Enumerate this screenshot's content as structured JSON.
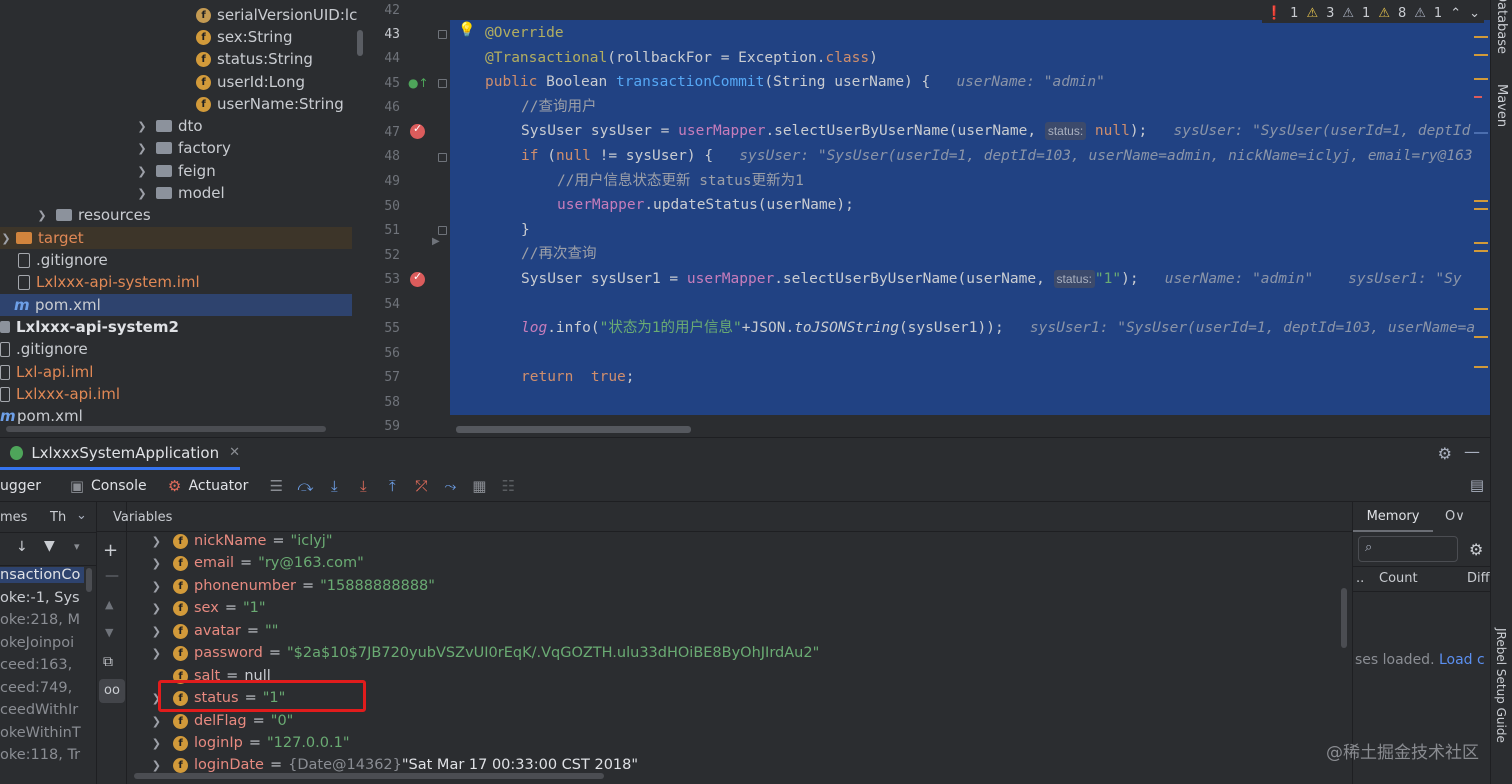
{
  "project": {
    "tree": [
      {
        "label": "serialVersionUID:lc",
        "type": "field-icon-alt",
        "style": "normal"
      },
      {
        "label": "sex:String",
        "type": "field",
        "style": "normal"
      },
      {
        "label": "status:String",
        "type": "field",
        "style": "normal"
      },
      {
        "label": "userId:Long",
        "type": "field",
        "style": "normal"
      },
      {
        "label": "userName:String",
        "type": "field",
        "style": "normal"
      },
      {
        "label": "dto",
        "type": "folder",
        "style": "normal"
      },
      {
        "label": "factory",
        "type": "folder",
        "style": "normal"
      },
      {
        "label": "feign",
        "type": "folder",
        "style": "normal"
      },
      {
        "label": "model",
        "type": "folder",
        "style": "normal"
      },
      {
        "label": "resources",
        "type": "folder",
        "style": "normal"
      },
      {
        "label": "target",
        "type": "folder-orange",
        "style": "orange"
      },
      {
        "label": ".gitignore",
        "type": "file",
        "style": "normal"
      },
      {
        "label": "Lxlxxx-api-system.iml",
        "type": "file",
        "style": "orange"
      },
      {
        "label": "pom.xml",
        "type": "maven",
        "style": "normal"
      },
      {
        "label": "Lxlxxx-api-system2",
        "type": "module",
        "style": "bold"
      },
      {
        "label": ".gitignore",
        "type": "file",
        "style": "normal"
      },
      {
        "label": "Lxl-api.iml",
        "type": "file",
        "style": "orange"
      },
      {
        "label": "Lxlxxx-api.iml",
        "type": "file",
        "style": "orange"
      },
      {
        "label": "pom.xml",
        "type": "maven",
        "style": "normal"
      }
    ]
  },
  "editor": {
    "line_numbers": [
      "42",
      "43",
      "44",
      "45",
      "46",
      "47",
      "48",
      "49",
      "50",
      "51",
      "52",
      "53",
      "54",
      "55",
      "56",
      "57",
      "58",
      "59"
    ],
    "inspections": {
      "errors": "1",
      "warn_a": "3",
      "warn_b": "1",
      "warn_c": "8",
      "warn_d": "1"
    },
    "code": {
      "l43": "@Override",
      "l44_ann": "@Transactional",
      "l44_rest_a": "(rollbackFor = Exception.",
      "l44_cls": "class",
      "l44_rest_b": ")",
      "l45_kw": "public",
      "l45_type": " Boolean ",
      "l45_fn": "transactionCommit",
      "l45_rest": "(String userName) {",
      "l45_hint": "userName: \"admin\"",
      "l46": "//查询用户",
      "l47_a": "SysUser sysUser = ",
      "l47_fld": "userMapper",
      "l47_b": ".selectUserByUserName(userName, ",
      "l47_chip": "status:",
      "l47_null": " null",
      "l47_c": ");",
      "l47_hint": "sysUser: \"SysUser(userId=1, deptId",
      "l48_kw": "if",
      "l48_a": " (",
      "l48_null": "null",
      "l48_b": " != sysUser) {",
      "l48_hint": "sysUser: \"SysUser(userId=1, deptId=103, userName=admin, nickName=iclyj, email=ry@163",
      "l49": "//用户信息状态更新 status更新为1",
      "l50_fld": "userMapper",
      "l50_rest": ".updateStatus(userName);",
      "l51": "}",
      "l52": "//再次查询",
      "l53_a": "SysUser sysUser1 = ",
      "l53_fld": "userMapper",
      "l53_b": ".selectUserByUserName(userName, ",
      "l53_chip": "status:",
      "l53_str": "\"1\"",
      "l53_c": ");",
      "l53_hint": "userName: \"admin\"    sysUser1: \"Sy",
      "l55_fld": "log",
      "l55_a": ".info(",
      "l55_str": "\"状态为1的用户信息\"",
      "l55_b": "+JSON.",
      "l55_fn": "toJSONString",
      "l55_c": "(sysUser1));",
      "l55_hint": "sysUser1: \"SysUser(userId=1, deptId=103, userName=a",
      "l57_kw": "return",
      "l57_val": "true",
      "l57_end": ";"
    }
  },
  "debug": {
    "tab_label": "LxlxxxSystemApplication",
    "toolbar": {
      "debugger": "ugger",
      "console": "Console",
      "actuator": "Actuator"
    },
    "frames_header": {
      "a": "mes",
      "b": "Th"
    },
    "variables_label": "Variables",
    "frames": [
      "nsactionCo",
      "oke:-1, Sys",
      "oke:218, M",
      "okeJoinpoi",
      "ceed:163,",
      "ceed:749,",
      "ceedWithIr",
      "okeWithinT",
      "oke:118, Tr"
    ],
    "variables": [
      {
        "name": "nickName",
        "value": "\"iclyj\"",
        "kind": "str",
        "expand": true
      },
      {
        "name": "email",
        "value": "\"ry@163.com\"",
        "kind": "str",
        "expand": true
      },
      {
        "name": "phonenumber",
        "value": "\"15888888888\"",
        "kind": "str",
        "expand": true
      },
      {
        "name": "sex",
        "value": "\"1\"",
        "kind": "str",
        "expand": true
      },
      {
        "name": "avatar",
        "value": "\"\"",
        "kind": "str",
        "expand": true
      },
      {
        "name": "password",
        "value": "\"$2a$10$7JB720yubVSZvUI0rEqK/.VqGOZTH.ulu33dHOiBE8ByOhJIrdAu2\"",
        "kind": "str",
        "expand": true
      },
      {
        "name": "salt",
        "value": "null",
        "kind": "null",
        "expand": false
      },
      {
        "name": "status",
        "value": "\"1\"",
        "kind": "str",
        "expand": true
      },
      {
        "name": "delFlag",
        "value": "\"0\"",
        "kind": "str",
        "expand": true
      },
      {
        "name": "loginIp",
        "value": "\"127.0.0.1\"",
        "kind": "str",
        "expand": true
      },
      {
        "name": "loginDate",
        "value": "{Date@14362}",
        "extra": "\"Sat Mar 17 00:33:00 CST 2018\"",
        "kind": "ref",
        "expand": true
      }
    ],
    "memory": {
      "tab": "Memory",
      "tab2": "O∨",
      "col_a": "..",
      "col_b": "Count",
      "col_c": "Diff",
      "loaded": "ses loaded. ",
      "load_link": "Load c"
    }
  },
  "stripe": {
    "database": "Database",
    "maven": "Maven",
    "jrebel": "JRebel Setup Guide"
  },
  "watermark": "@稀土掘金技术社区"
}
